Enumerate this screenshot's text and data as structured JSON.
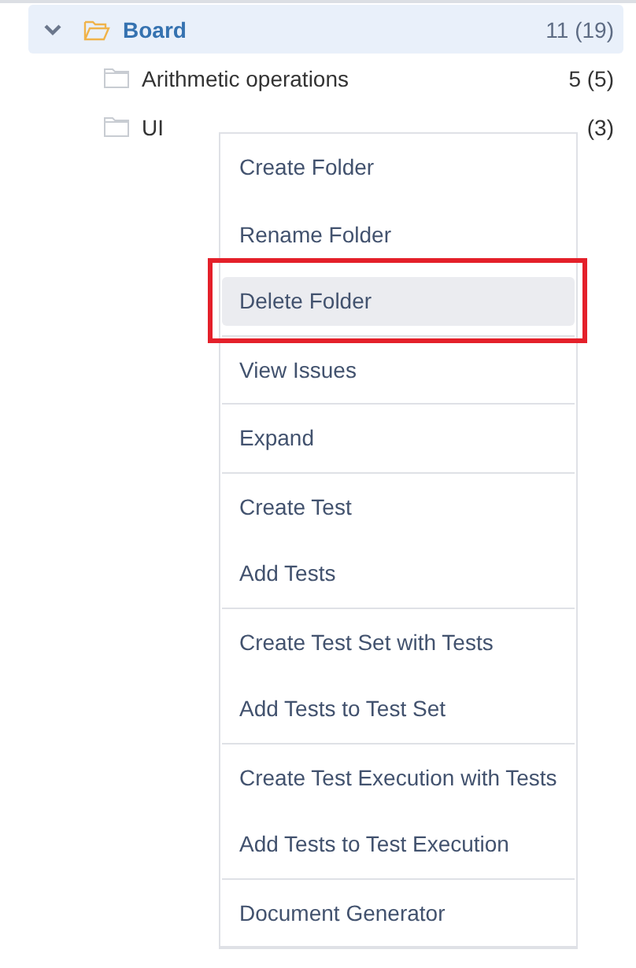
{
  "tree": {
    "root": {
      "label": "Board",
      "count": "11 (19)",
      "expanded": true,
      "selected": true,
      "children": [
        {
          "label": "Arithmetic operations",
          "count": "5 (5)"
        },
        {
          "label": "UI",
          "count": "(3)"
        }
      ]
    }
  },
  "context_menu": {
    "groups": [
      {
        "items": [
          {
            "label": "Create Folder",
            "selected": false,
            "annotated": false
          },
          {
            "label": "Rename Folder",
            "selected": false,
            "annotated": false
          },
          {
            "label": "Delete Folder",
            "selected": true,
            "annotated": true
          }
        ]
      },
      {
        "items": [
          {
            "label": "View Issues",
            "selected": false,
            "annotated": false
          }
        ]
      },
      {
        "items": [
          {
            "label": "Expand",
            "selected": false,
            "annotated": false
          }
        ]
      },
      {
        "items": [
          {
            "label": "Create Test",
            "selected": false,
            "annotated": false
          },
          {
            "label": "Add Tests",
            "selected": false,
            "annotated": false
          }
        ]
      },
      {
        "items": [
          {
            "label": "Create Test Set with Tests",
            "selected": false,
            "annotated": false
          },
          {
            "label": "Add Tests to Test Set",
            "selected": false,
            "annotated": false
          }
        ]
      },
      {
        "items": [
          {
            "label": "Create Test Execution with Tests",
            "selected": false,
            "annotated": false
          },
          {
            "label": "Add Tests to Test Execution",
            "selected": false,
            "annotated": false
          }
        ]
      },
      {
        "items": [
          {
            "label": "Document Generator",
            "selected": false,
            "annotated": false
          }
        ]
      }
    ]
  }
}
